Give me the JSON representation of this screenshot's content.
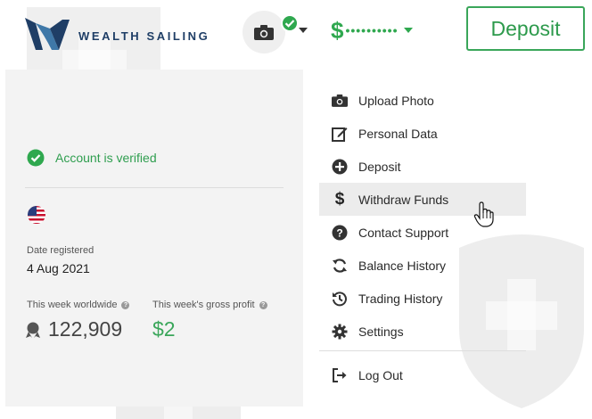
{
  "header": {
    "brand_name": "WEALTH SAILING",
    "balance_currency": "$",
    "balance_masked": "••••••••••",
    "deposit_label": "Deposit"
  },
  "account": {
    "verified_label": "Account is verified",
    "date_registered_label": "Date registered",
    "date_registered_value": "4 Aug 2021",
    "week_worldwide_label": "This week worldwide",
    "week_worldwide_value": "122,909",
    "week_profit_label": "This week's gross profit",
    "week_profit_value": "$2"
  },
  "menu": {
    "items": [
      {
        "label": "Upload Photo",
        "icon": "camera-icon"
      },
      {
        "label": "Personal Data",
        "icon": "edit-icon"
      },
      {
        "label": "Deposit",
        "icon": "plus-circle-icon"
      },
      {
        "label": "Withdraw Funds",
        "icon": "dollar-icon",
        "active": true
      },
      {
        "label": "Contact Support",
        "icon": "question-circle-icon"
      },
      {
        "label": "Balance History",
        "icon": "refresh-icon"
      },
      {
        "label": "Trading History",
        "icon": "history-icon"
      },
      {
        "label": "Settings",
        "icon": "gear-icon"
      },
      {
        "label": "Log Out",
        "icon": "logout-icon"
      }
    ]
  },
  "colors": {
    "accent_green": "#2fa84f",
    "brand_navy": "#1f3e66",
    "panel_bg": "#f3f3f3"
  }
}
